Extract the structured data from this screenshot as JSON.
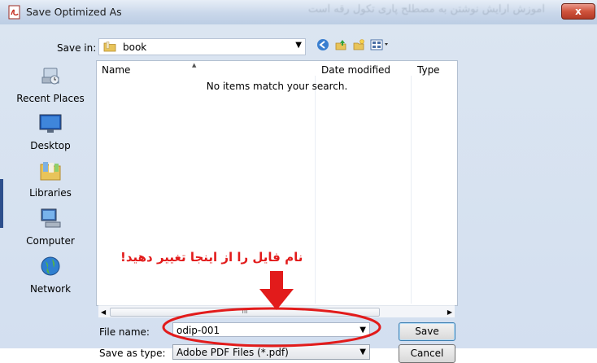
{
  "window": {
    "title": "Save Optimized As",
    "watermark": "آموزش آرایش نوشتن به مصطلح پاری تکول رقه آست",
    "close_glyph": "x"
  },
  "toolbar": {
    "save_in_label": "Save in:",
    "save_in_value": "book"
  },
  "places": [
    {
      "label": "Recent Places",
      "icon": "recent-places-icon"
    },
    {
      "label": "Desktop",
      "icon": "desktop-icon"
    },
    {
      "label": "Libraries",
      "icon": "libraries-icon"
    },
    {
      "label": "Computer",
      "icon": "computer-icon"
    },
    {
      "label": "Network",
      "icon": "network-icon"
    }
  ],
  "file_list": {
    "columns": [
      "Name",
      "Date modified",
      "Type"
    ],
    "empty_message": "No items match your search.",
    "scroll_mark": "III"
  },
  "form": {
    "file_name_label": "File name:",
    "file_name_value": "odip-001",
    "save_as_type_label": "Save as type:",
    "save_as_type_value": "Adobe PDF Files (*.pdf)"
  },
  "buttons": {
    "save": "Save",
    "cancel": "Cancel"
  },
  "annotation": {
    "text": "نام فایل را از اینجا تغییر دهید!",
    "color": "#e21b1b"
  }
}
